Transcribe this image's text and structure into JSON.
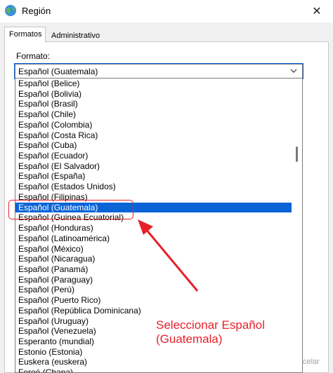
{
  "window": {
    "title": "Región",
    "close_glyph": "✕",
    "icon": "globe-icon"
  },
  "tabs": [
    {
      "label": "Formatos",
      "active": true
    },
    {
      "label": "Administrativo",
      "active": false
    }
  ],
  "format_section": {
    "label": "Formato:",
    "selected_value": "Español (Guatemala)"
  },
  "dropdown": {
    "items": [
      "Español (Belice)",
      "Español (Bolivia)",
      "Español (Brasil)",
      "Español (Chile)",
      "Español (Colombia)",
      "Español (Costa Rica)",
      "Español (Cuba)",
      "Español (Ecuador)",
      "Español (El Salvador)",
      "Español (España)",
      "Español (Estados Unidos)",
      "Español (Filipinas)",
      "Español (Guatemala)",
      "Español (Guinea Ecuatorial)",
      "Español (Honduras)",
      "Español (Latinoamérica)",
      "Español (México)",
      "Español (Nicaragua)",
      "Español (Panamá)",
      "Español (Paraguay)",
      "Español (Perú)",
      "Español (Puerto Rico)",
      "Español (República Dominicana)",
      "Español (Uruguay)",
      "Español (Venezuela)",
      "Esperanto (mundial)",
      "Estonio (Estonia)",
      "Euskera (euskera)",
      "Feroé (Chana)"
    ],
    "selected_index": 12
  },
  "background_button": {
    "label": "celar"
  },
  "annotation": {
    "text": "Seleccionar Español (Guatemala)",
    "color": "#e8202a"
  },
  "colors": {
    "selection": "#0a64d6",
    "annotation": "#e8202a"
  }
}
